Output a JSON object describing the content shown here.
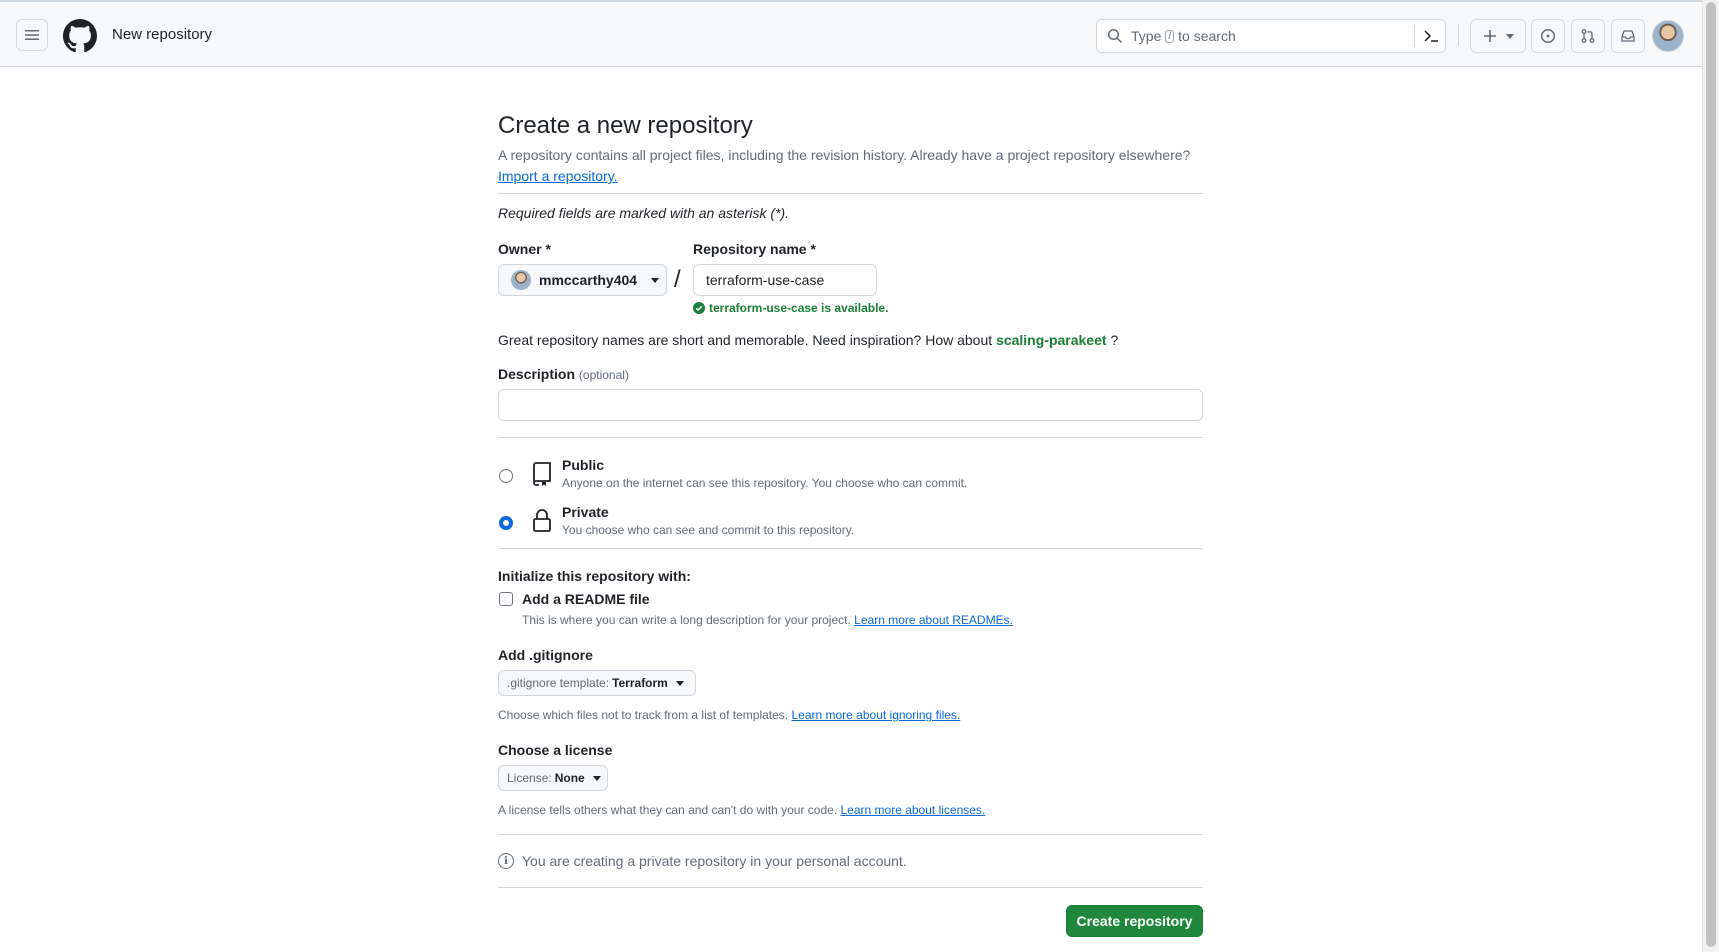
{
  "header": {
    "page_context": "New repository",
    "search": {
      "prefix": "Type",
      "key": "/",
      "suffix": "to search"
    }
  },
  "main": {
    "title": "Create a new repository",
    "subtitle": "A repository contains all project files, including the revision history. Already have a project repository elsewhere?",
    "import_link": "Import a repository.",
    "required_note": "Required fields are marked with an asterisk (*).",
    "owner_label": "Owner *",
    "owner_value": "mmccarthy404",
    "slash": "/",
    "repo_label": "Repository name *",
    "repo_value": "terraform-use-case",
    "available_text": "terraform-use-case is available.",
    "suggestion_prefix": "Great repository names are short and memorable. Need inspiration? How about",
    "suggestion_name": "scaling-parakeet",
    "suggestion_suffix": "?",
    "description_label": "Description",
    "description_optional": "(optional)",
    "description_value": "",
    "visibility": {
      "selected": "Private",
      "options": [
        {
          "title": "Public",
          "desc": "Anyone on the internet can see this repository. You choose who can commit."
        },
        {
          "title": "Private",
          "desc": "You choose who can see and commit to this repository."
        }
      ]
    },
    "init_title": "Initialize this repository with:",
    "readme_label": "Add a README file",
    "readme_checked": false,
    "readme_desc": "This is where you can write a long description for your project.",
    "readme_link": "Learn more about READMEs.",
    "gitignore_label": "Add .gitignore",
    "gitignore_prefix": ".gitignore template:",
    "gitignore_value": "Terraform",
    "gitignore_note": "Choose which files not to track from a list of templates.",
    "gitignore_link": "Learn more about ignoring files.",
    "license_label": "Choose a license",
    "license_prefix": "License:",
    "license_value": "None",
    "license_note": "A license tells others what they can and can't do with your code.",
    "license_link": "Learn more about licenses.",
    "info_text": "You are creating a private repository in your personal account.",
    "create_button": "Create repository"
  },
  "colors": {
    "primary_button": "#1f883d",
    "link": "#0969da",
    "success": "#1a7f37",
    "border": "#d0d7de"
  }
}
